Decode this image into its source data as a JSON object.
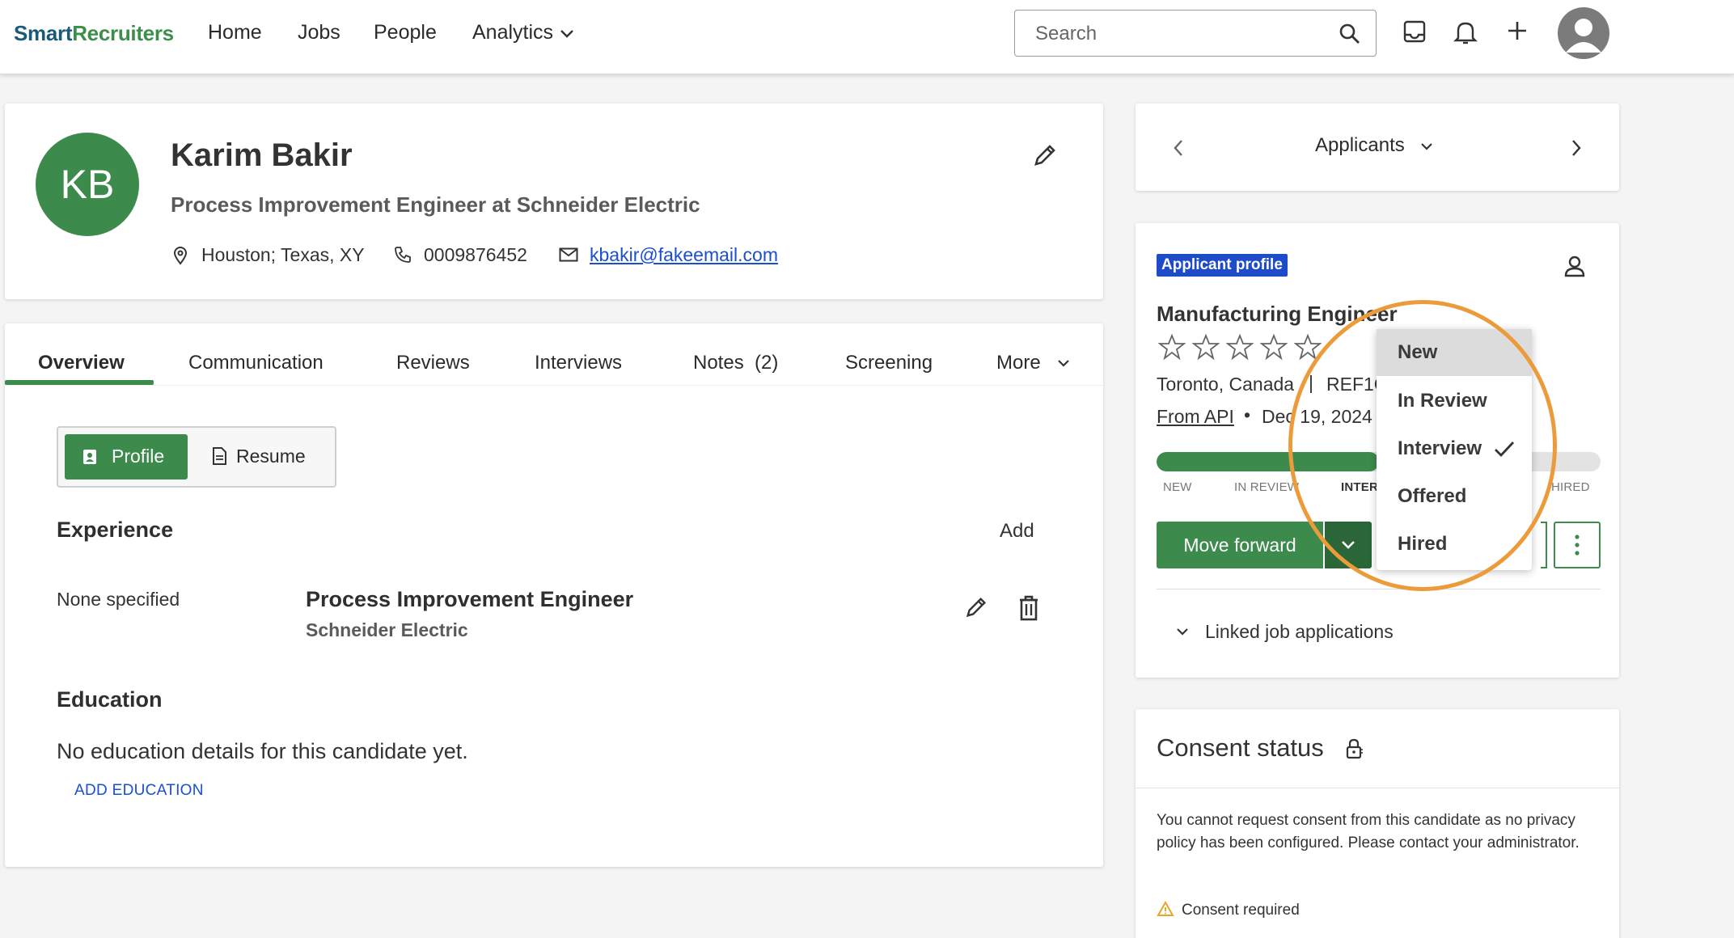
{
  "app": {
    "logo_part1": "Smart",
    "logo_part2": "Recruiters"
  },
  "nav": {
    "home": "Home",
    "jobs": "Jobs",
    "people": "People",
    "analytics": "Analytics"
  },
  "search": {
    "placeholder": "Search"
  },
  "candidate": {
    "initials": "KB",
    "name": "Karim Bakir",
    "headline": "Process Improvement Engineer at Schneider Electric",
    "location": "Houston; Texas, XY",
    "phone": "0009876452",
    "email": "kbakir@fakeemail.com"
  },
  "tabs": {
    "overview": "Overview",
    "communication": "Communication",
    "reviews": "Reviews",
    "interviews": "Interviews",
    "notes": "Notes",
    "notes_count": "(2)",
    "screening": "Screening",
    "more": "More"
  },
  "toggle": {
    "profile": "Profile",
    "resume": "Resume"
  },
  "experience": {
    "heading": "Experience",
    "add": "Add",
    "dates": "None specified",
    "title": "Process Improvement Engineer",
    "company": "Schneider Electric"
  },
  "education": {
    "heading": "Education",
    "empty": "No education details for this candidate yet.",
    "add": "ADD EDUCATION"
  },
  "applicants_nav": {
    "label": "Applicants"
  },
  "application": {
    "badge": "Applicant profile",
    "job_title": "Manufacturing Engineer",
    "rating_stars": 0,
    "location": "Toronto, Canada",
    "ref": "REF1C",
    "source": "From API",
    "date": "Dec 19, 2024",
    "progress_fraction": 0.5,
    "stages": [
      "NEW",
      "IN REVIEW",
      "INTER",
      "HIRED"
    ],
    "move_forward": "Move forward",
    "linked": "Linked job applications"
  },
  "status_dropdown": {
    "items": [
      "New",
      "In Review",
      "Interview",
      "Offered",
      "Hired"
    ],
    "highlighted": "New",
    "checked": "Interview"
  },
  "consent": {
    "heading": "Consent status",
    "message": "You cannot request consent from this candidate as no privacy policy has been configured. Please contact your administrator.",
    "required": "Consent required"
  },
  "colors": {
    "brand_green": "#3c8a4c",
    "link_blue": "#1a4fd1",
    "badge_blue": "#1d4bc9",
    "ring_orange": "#ec9b3b"
  }
}
